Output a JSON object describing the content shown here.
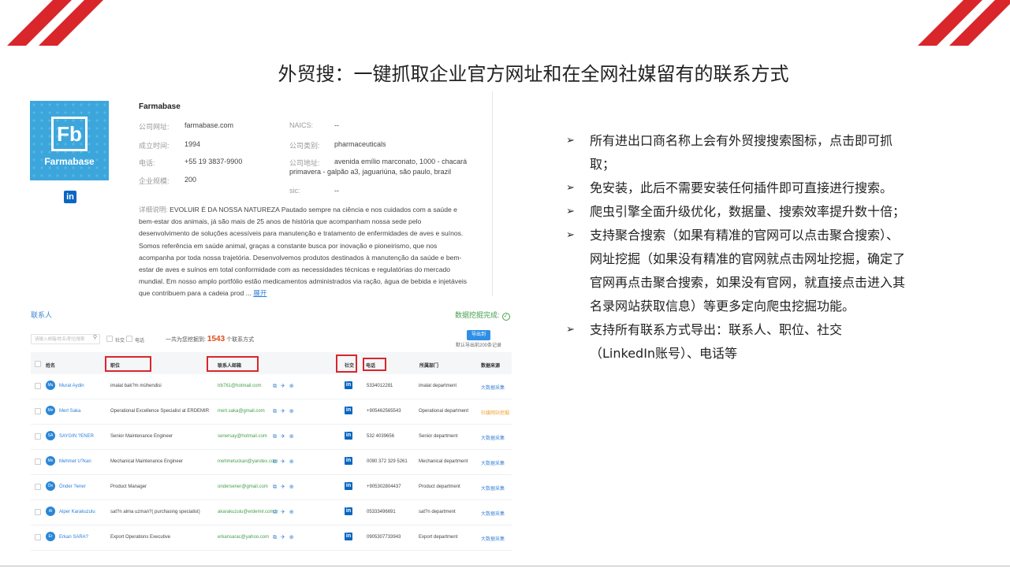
{
  "title": "外贸搜：一键抓取企业官方网址和在全网社媒留有的联系方式",
  "company": {
    "name": "Farmabase",
    "logo_text": "Fb",
    "logo_name": "Farmabase",
    "linkedin_icon": "in",
    "fields": {
      "website_label": "公司网址:",
      "website": "farmabase.com",
      "founded_label": "成立时间:",
      "founded": "1994",
      "phone_label": "电话:",
      "phone": "+55 19 3837-9900",
      "size_label": "企业规模:",
      "size": "200",
      "naics_label": "NAICS:",
      "naics": "--",
      "type_label": "公司类别:",
      "type": "pharmaceuticals",
      "address_label": "公司地址:",
      "address_line1": "avenida emílio marconato, 1000 - chacará",
      "address_line2": "primavera - galpão a3, jaguariúna, são paulo, brazil",
      "sic_label": "sic:",
      "sic": "--"
    },
    "desc_label": "详细说明:",
    "description": "EVOLUIR É DA NOSSA NATUREZA Pautado sempre na ciência e nos cuidados com a saúde e bem-estar dos animais, já são mais de 25 anos de história que acompanham nossa sede pelo desenvolvimento de soluções acessíveis para manutenção e tratamento de enfermidades de aves e suínos. Somos referência em saúde animal, graças a constante busca por inovação e pioneirismo, que nos acompanha por toda nossa trajetória. Desenvolvemos produtos destinados à manutenção da saúde e bem-estar de aves e suínos em total conformidade com as necessidades técnicas e regulatórias do mercado mundial. Em nosso amplo portfólio estão medicamentos administrados via ração, água de bebida e injetáveis que contribuem para a cadeia prod ...",
    "expand": "展开"
  },
  "contacts": {
    "title": "联系人",
    "status": "数据挖掘完成:",
    "search_placeholder": "请输入邮箱/姓名/职位搜索",
    "filter_social": "社交",
    "filter_phone": "电话",
    "count_prefix": "一共为您挖掘到:",
    "count": "1543",
    "count_suffix": "个联系方式",
    "export_label": "导出到",
    "export_note": "默认导出前200条记录",
    "headers": [
      "姓名",
      "职位",
      "联系人邮箱",
      "社交",
      "电话",
      "所属部门",
      "数据来源"
    ],
    "rows": [
      {
        "initials": "Mu",
        "name": "Murat Aydin",
        "position": "imalat bak?m mühendisi",
        "email": "trb761@hotmail.com",
        "phone": "5334012281",
        "dept": "imalat department",
        "source": "大数据采集",
        "source_color": "#3e86d6"
      },
      {
        "initials": "Me",
        "name": "Mert Saka",
        "position": "Operational Excellence Specialist at ERDEMIR",
        "email": "mert.saka@gmail.com",
        "phone": "+905462565543",
        "dept": "Operational department",
        "source": "社媒网站挖掘",
        "source_color": "#f0a030"
      },
      {
        "initials": "SA",
        "name": "SAYGIN ?ENER",
        "position": "Senior Maintenance Engineer",
        "email": "senersay@hotmail.com",
        "phone": "532 4039656",
        "dept": "Senior department",
        "source": "大数据采集",
        "source_color": "#3e86d6"
      },
      {
        "initials": "Me",
        "name": "Mehmet U?kan",
        "position": "Mechanical Maintenance Engineer",
        "email": "mehmetuckan@yandex.com",
        "phone": "0090 372 329 5261",
        "dept": "Mechanical department",
        "source": "大数据采集",
        "source_color": "#3e86d6"
      },
      {
        "initials": "Ön",
        "name": "Önder ?ener",
        "position": "Product Manager",
        "email": "ondersener@gmail.com",
        "phone": "+905302804437",
        "dept": "Product department",
        "source": "大数据采集",
        "source_color": "#3e86d6"
      },
      {
        "initials": "Al",
        "name": "Alper Karakuzulu",
        "position": "sat?n alma uzman?( purchasing specialist)",
        "email": "akarakuzulu@erdemir.com.tr",
        "phone": "05333496691",
        "dept": "sat?n department",
        "source": "大数据采集",
        "source_color": "#3e86d6"
      },
      {
        "initials": "Er",
        "name": "Erkan SARA?",
        "position": "Export Operations Executive",
        "email": "erkansarac@yahoo.com",
        "phone": "0905307733943",
        "dept": "Export department",
        "source": "大数据采集",
        "source_color": "#3e86d6"
      }
    ]
  },
  "bullets": [
    "所有进出口商名称上会有外贸搜搜索图标，点击即可抓取；",
    "免安装，此后不需要安装任何插件即可直接进行搜索。",
    "爬虫引擎全面升级优化，数据量、搜索效率提升数十倍；",
    "支持聚合搜索（如果有精准的官网可以点击聚合搜索）、网址挖掘（如果没有精准的官网就点击网址挖掘，确定了官网再点击聚合搜索，如果没有官网，就直接点击进入其名录网站获取信息）等更多定向爬虫挖掘功能。",
    "支持所有联系方式导出：联系人、职位、社交（LinkedIn账号）、电话等"
  ],
  "colors": {
    "accent_red": "#d9262b",
    "link_blue": "#2f7fd9",
    "green": "#46a04c",
    "linkedin": "#0a66c2"
  }
}
